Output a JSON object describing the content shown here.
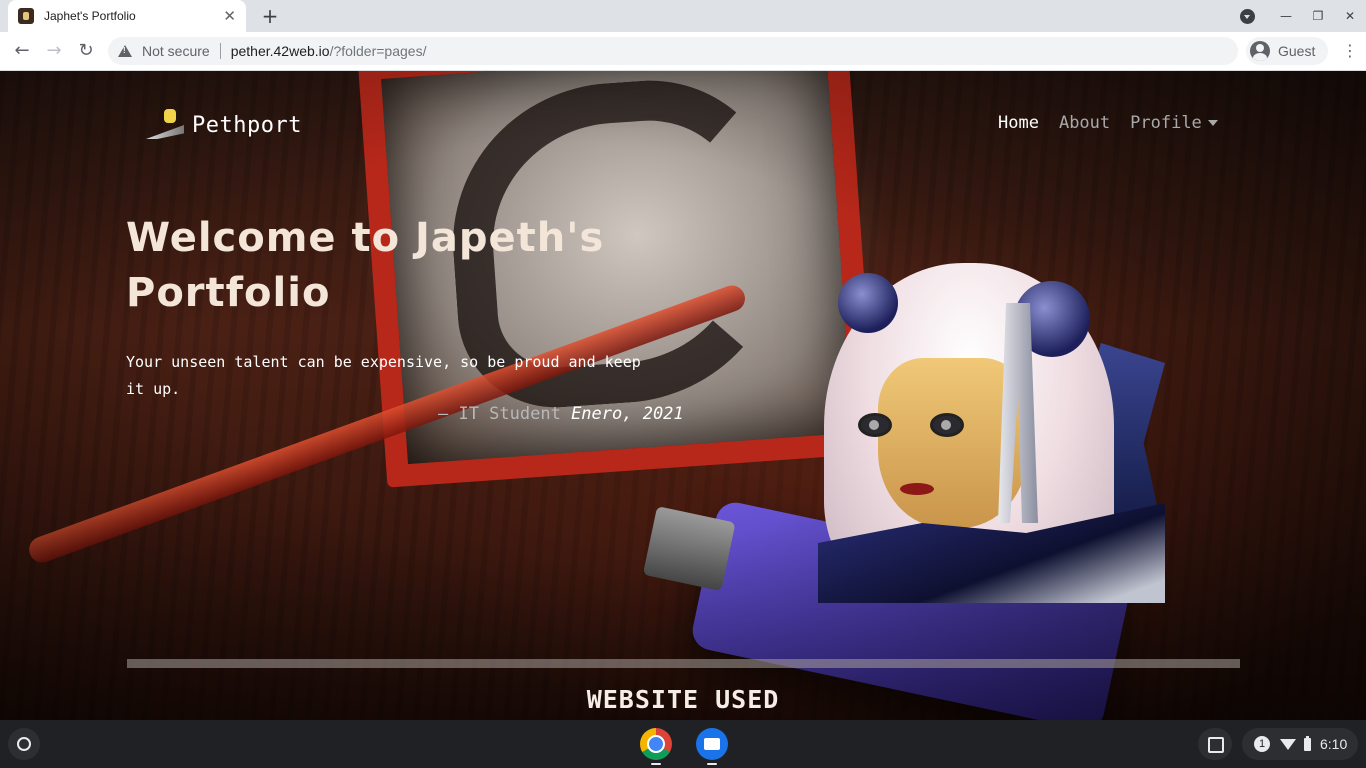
{
  "browser": {
    "tab_title": "Japhet's Portfolio",
    "tab_close": "✕",
    "new_tab": "+",
    "security_label": "Not secure",
    "url_host": "pether.42web.io",
    "url_path": "/?folder=pages/",
    "profile_label": "Guest",
    "back": "←",
    "forward": "→",
    "reload": "↻",
    "menu": "⋮",
    "minimize": "—",
    "restore": "❐",
    "close": "✕"
  },
  "site": {
    "brand": "Pethport",
    "nav": {
      "home": "Home",
      "about": "About",
      "profile": "Profile"
    },
    "hero": {
      "title": "Welcome to Japeth's Portfolio",
      "quote": "Your unseen talent can be expensive, so be proud and keep it up.",
      "cite_prefix": "— IT Student ",
      "cite_name": "Enero, 2021"
    },
    "section_title": "WEBSITE USED"
  },
  "shelf": {
    "notification_count": "1",
    "time": "6:10"
  },
  "colors": {
    "nav_active": "#ffffff",
    "nav_inactive": "#a9a9a9",
    "hero_title": "#f3e5d8"
  }
}
